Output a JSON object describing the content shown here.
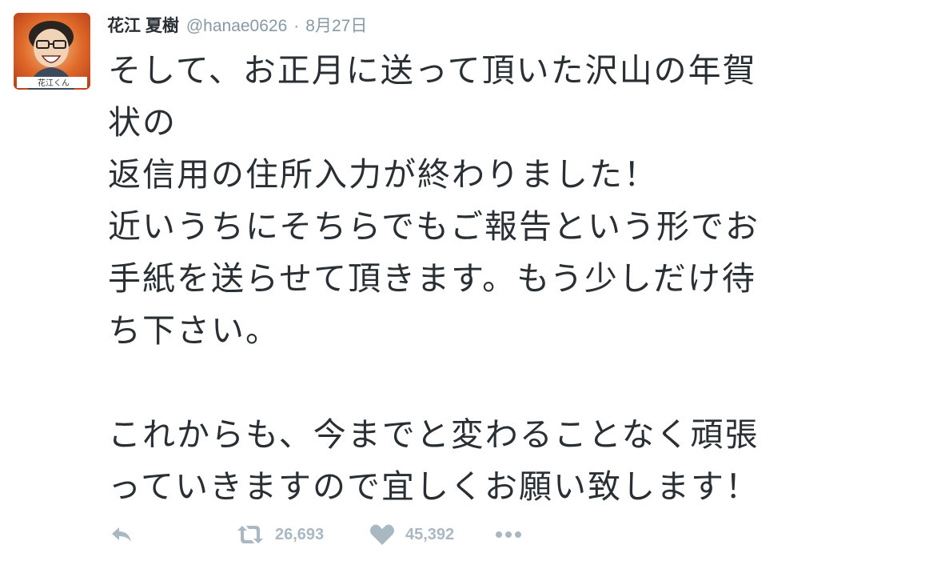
{
  "tweet": {
    "avatar_label": "花江くん",
    "display_name": "花江 夏樹",
    "handle": "@hanae0626",
    "separator": "·",
    "date": "8月27日",
    "text_lines": [
      "そして、お正月に送って頂いた沢山の年賀",
      "状の",
      "返信用の住所入力が終わりました！",
      "近いうちにそちらでもご報告という形でお",
      "手紙を送らせて頂きます。もう少しだけ待",
      "ち下さい。",
      "",
      "これからも、今までと変わることなく頑張",
      "っていきますので宜しくお願い致します！"
    ],
    "actions": {
      "reply_icon": "reply-icon",
      "retweet_icon": "retweet-icon",
      "retweet_count": "26,693",
      "like_icon": "heart-icon",
      "like_count": "45,392",
      "more_icon": "more-dots-icon"
    },
    "colors": {
      "text": "#292f33",
      "muted": "#8899a6",
      "action": "#aab8c2"
    }
  }
}
